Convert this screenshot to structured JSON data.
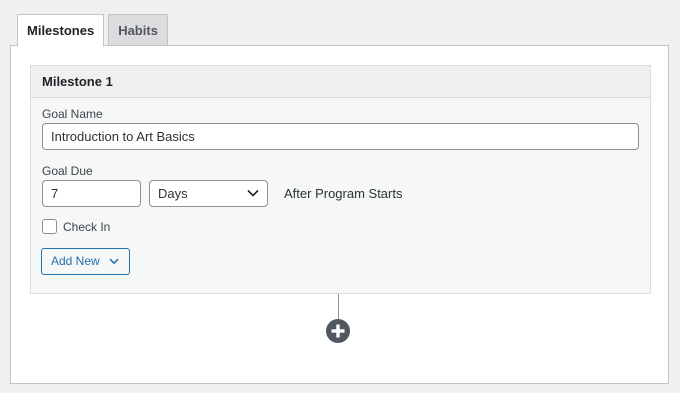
{
  "tabs": [
    {
      "label": "Milestones",
      "active": true
    },
    {
      "label": "Habits",
      "active": false
    }
  ],
  "milestone": {
    "title": "Milestone 1",
    "goal_name_label": "Goal Name",
    "goal_name_value": "Introduction to Art Basics",
    "goal_due_label": "Goal Due",
    "goal_due_value": "7",
    "goal_due_unit": "Days",
    "goal_due_suffix": "After Program Starts",
    "check_in_label": "Check In",
    "check_in_checked": false,
    "add_new_label": "Add New"
  },
  "icons": {
    "add_milestone": "plus-circle-icon",
    "select_chevron": "chevron-down-icon",
    "add_new_chevron": "chevron-down-icon"
  },
  "colors": {
    "accent": "#2271b1",
    "plus_button": "#50575e"
  }
}
